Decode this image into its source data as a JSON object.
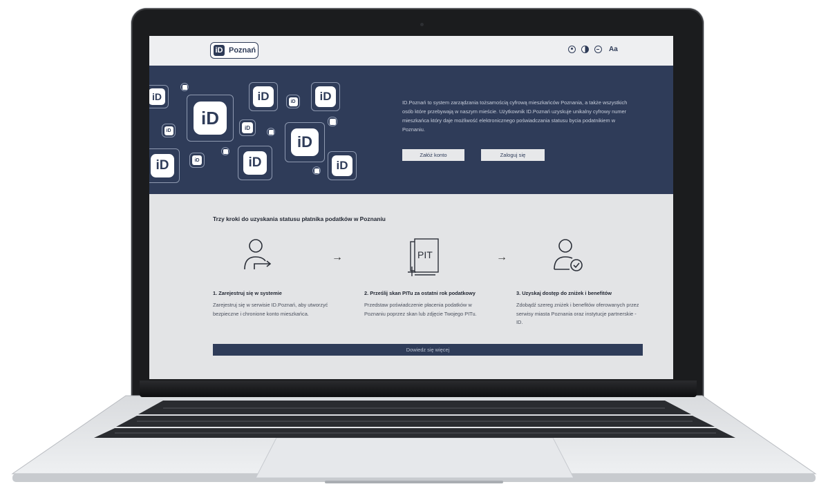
{
  "header": {
    "logo_text": "Poznań",
    "logo_mark": "iD",
    "tools": [
      "user-icon",
      "contrast-icon",
      "minus-icon"
    ],
    "font_size_label": "Aa"
  },
  "hero": {
    "description": "ID.Poznań to system zarządzania tożsamością cyfrową mieszkańców Poznania, a także wszystkich osób które przebywają w naszym mieście. Użytkownik ID.Poznań uzyskuje unikalny cyfrowy numer mieszkańca który daje możliwość elektronicznego poświadczania statusu bycia podatnikiem w Poznaniu.",
    "register_button": "Załóż konto",
    "login_button": "Zaloguj się"
  },
  "steps": {
    "title": "Trzy kroki do uzyskania statusu płatnika podatków w Poznaniu",
    "items": [
      {
        "heading": "1. Zarejestruj się w systemie",
        "text": "Zarejestruj się w serwisie ID.Poznań, aby utworzyć bezpieczne i chronione konto mieszkańca.",
        "icon": "user-register-icon"
      },
      {
        "heading": "2. Prześlij skan PITu za ostatni rok podatkowy",
        "text": "Przedstaw poświadczenie płacenia podatków w Poznaniu poprzez skan lub zdjęcie Twojego PITu.",
        "icon": "pit-document-icon",
        "icon_label": "PIT"
      },
      {
        "heading": "3. Uzyskaj dostęp do zniżek i benefitów",
        "text": "Zdobądź szereg zniżek i benefitów oferowanych przez serwisy miasta Poznania oraz instytucje partnerskie - ID.",
        "icon": "user-verified-icon"
      }
    ],
    "arrow": "→"
  },
  "learn_more": "Dowiedz się więcej",
  "colors": {
    "navy": "#2f3c59",
    "screen_bg": "#e3e4e6"
  }
}
